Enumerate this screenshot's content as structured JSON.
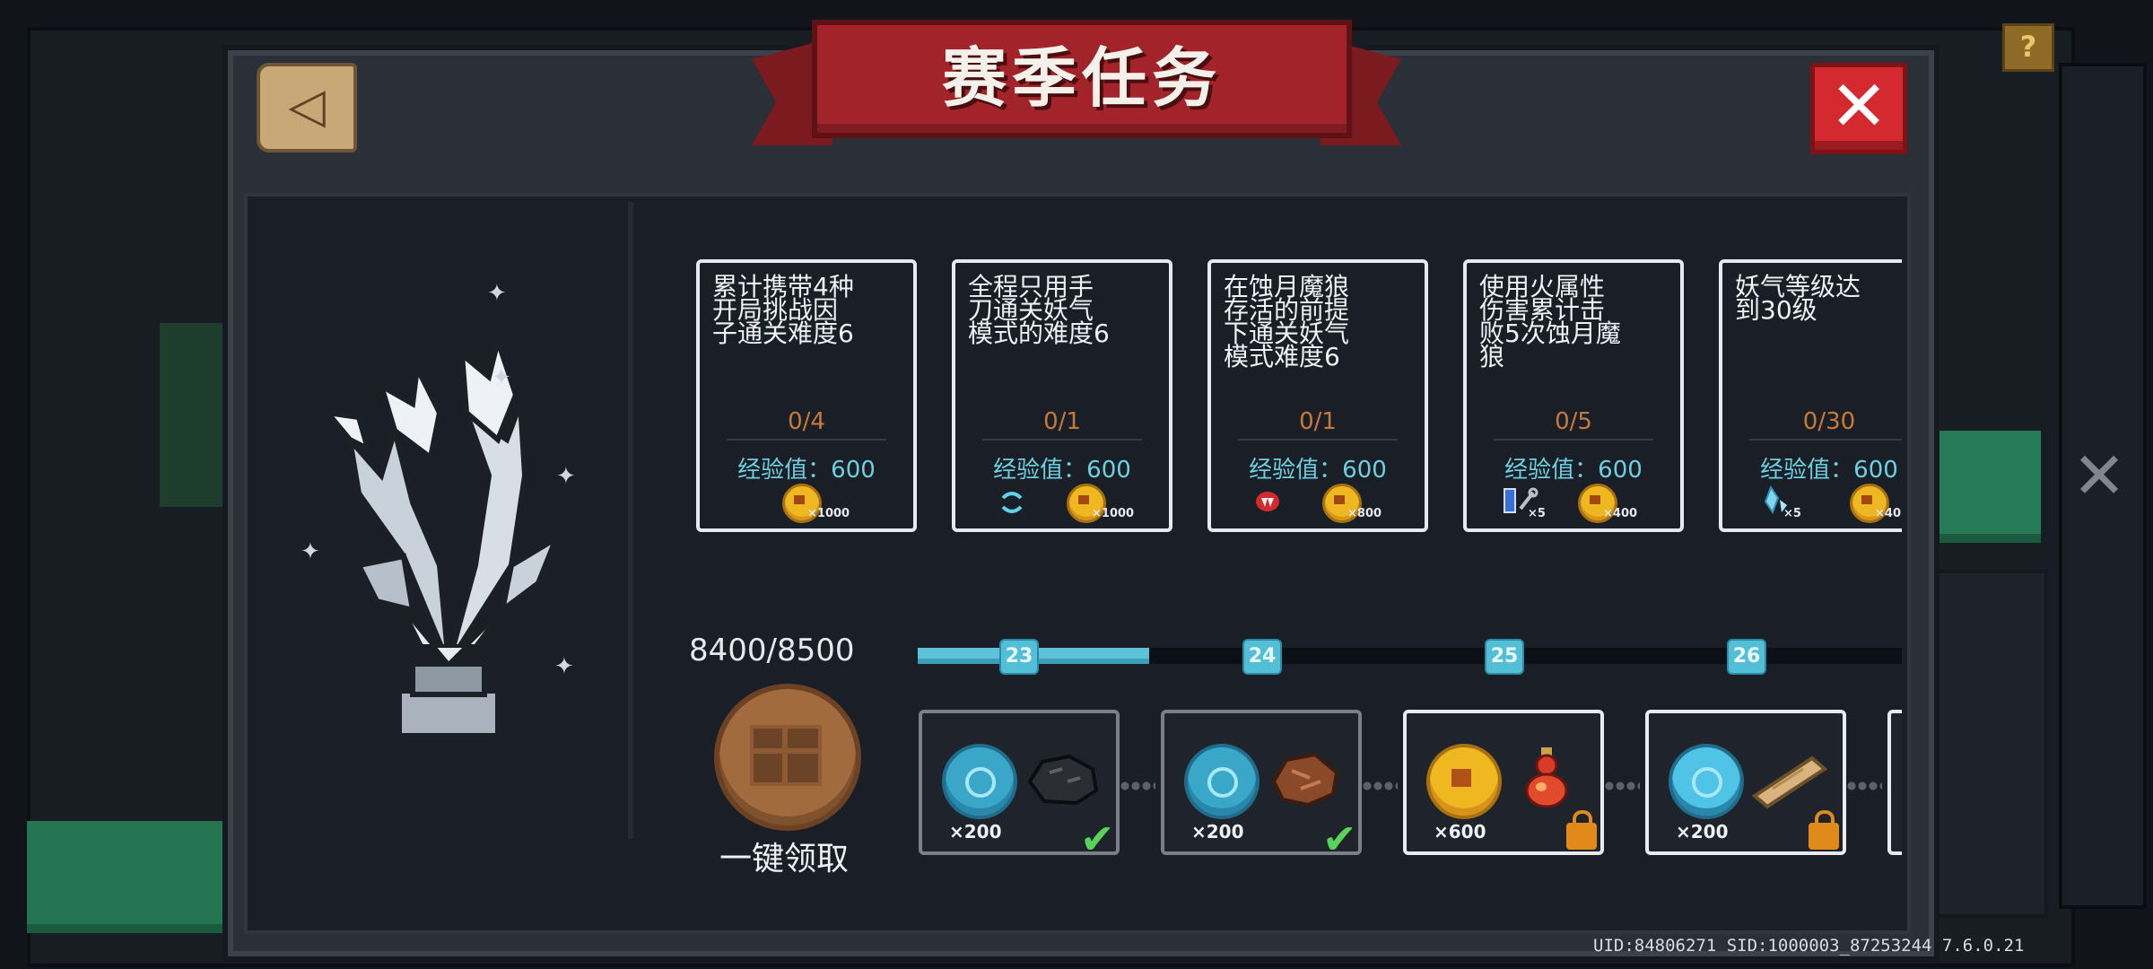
{
  "title": "赛季任务",
  "help_label": "?",
  "tasks": [
    {
      "desc": "累计携带4种\n开局挑战因\n子通关难度6",
      "progress": "0/4",
      "exp": "经验值：600",
      "rewards": [
        {
          "icon": "gold-coin",
          "mult": "×1000"
        }
      ]
    },
    {
      "desc": "全程只用手\n刀通关妖气\n模式的难度6",
      "progress": "0/1",
      "exp": "经验值：600",
      "rewards": [
        {
          "icon": "blue-swirl",
          "mult": ""
        },
        {
          "icon": "gold-coin",
          "mult": "×1000"
        }
      ]
    },
    {
      "desc": "在蚀月魔狼\n存活的前提\n下通关妖气\n模式难度6",
      "progress": "0/1",
      "exp": "经验值：600",
      "rewards": [
        {
          "icon": "red-fang",
          "mult": ""
        },
        {
          "icon": "gold-coin",
          "mult": "×800"
        }
      ]
    },
    {
      "desc": "使用火属性\n伤害累计击\n败5次蚀月魔\n狼",
      "progress": "0/5",
      "exp": "经验值：600",
      "rewards": [
        {
          "icon": "battery-wrench",
          "mult": "×5"
        },
        {
          "icon": "gold-coin",
          "mult": "×400"
        }
      ]
    },
    {
      "desc": "妖气等级达\n到30级",
      "progress": "0/30",
      "exp": "经验值：600",
      "rewards": [
        {
          "icon": "blue-crystal",
          "mult": "×5"
        },
        {
          "icon": "gold-coin",
          "mult": "×40"
        }
      ]
    }
  ],
  "season": {
    "exp_total": "8400/8500",
    "progress_fraction": 0.235,
    "levels": [
      "23",
      "24",
      "25",
      "26"
    ],
    "claim_all_label": "一键领取"
  },
  "level_rewards": [
    {
      "coin": "blue",
      "mult": "×200",
      "item": "coal-ore",
      "status": "claimed"
    },
    {
      "coin": "blue",
      "mult": "×200",
      "item": "meat",
      "status": "claimed"
    },
    {
      "coin": "gold",
      "mult": "×600",
      "item": "red-gourd",
      "status": "locked"
    },
    {
      "coin": "blue",
      "mult": "×200",
      "item": "wood-plank",
      "status": "locked"
    }
  ],
  "footer": "UID:84806271 SID:1000003_87253244 7.6.0.21",
  "colors": {
    "ribbon": "#a3232a",
    "exp_text": "#6dd0e0",
    "progress_text": "#c67a3a",
    "track_fill": "#5ec3d9",
    "close": "#d42a2f",
    "check": "#58d35a",
    "lock": "#e08a1a"
  }
}
